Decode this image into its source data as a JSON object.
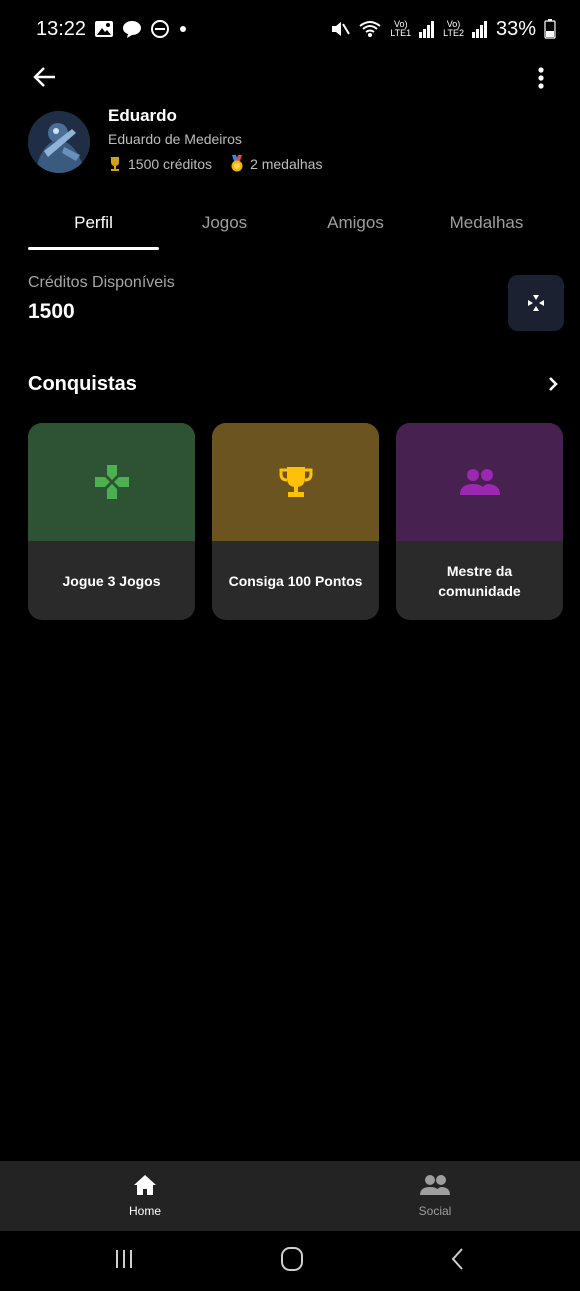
{
  "status_bar": {
    "time": "13:22",
    "battery": "33%",
    "sim1_label": "Vo)",
    "sim1_sub": "LTE1",
    "sim2_label": "Vo)",
    "sim2_sub": "LTE2"
  },
  "profile": {
    "name": "Eduardo",
    "full_name": "Eduardo de Medeiros",
    "credits_text": "1500 créditos",
    "medals_text": "2 medalhas"
  },
  "tabs": [
    {
      "label": "Perfil",
      "active": true
    },
    {
      "label": "Jogos",
      "active": false
    },
    {
      "label": "Amigos",
      "active": false
    },
    {
      "label": "Medalhas",
      "active": false
    }
  ],
  "credits": {
    "label": "Créditos Disponíveis",
    "value": "1500"
  },
  "achievements": {
    "title": "Conquistas",
    "items": [
      {
        "label": "Jogue 3 Jogos",
        "icon": "gamepad-icon",
        "color": "#2e5234",
        "icon_color": "#4caf50"
      },
      {
        "label": "Consiga 100 Pontos",
        "icon": "trophy-icon",
        "color": "#6b541f",
        "icon_color": "#ffc107"
      },
      {
        "label": "Mestre da comunidade",
        "icon": "people-icon",
        "color": "#47214f",
        "icon_color": "#9c27b0"
      }
    ]
  },
  "bottom_nav": {
    "home_label": "Home",
    "social_label": "Social"
  },
  "colors": {
    "background": "#000000",
    "nav_background": "#232323",
    "game_button": "#1a2232"
  }
}
